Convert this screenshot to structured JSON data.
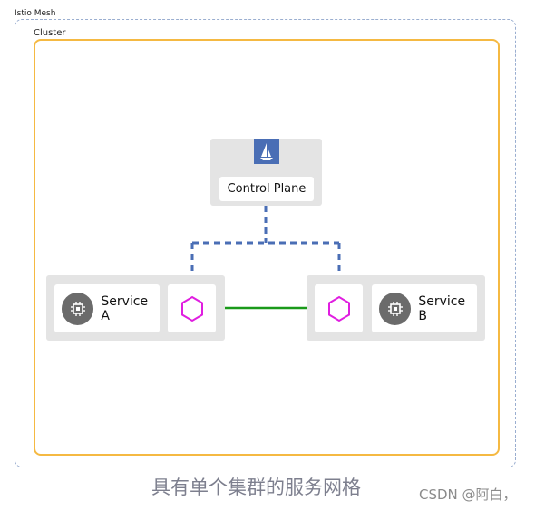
{
  "mesh": {
    "label": "Istio Mesh"
  },
  "cluster": {
    "label": "Cluster"
  },
  "control_plane": {
    "label": "Control Plane",
    "logo_icon": "istio-sail-icon",
    "logo_color": "#4a6eb5"
  },
  "services": [
    {
      "label": "Service A",
      "icon": "chip-icon"
    },
    {
      "label": "Service B",
      "icon": "chip-icon"
    }
  ],
  "proxies": [
    {
      "icon": "envoy-hexagon-icon",
      "color": "#e01ee0"
    },
    {
      "icon": "envoy-hexagon-icon",
      "color": "#e01ee0"
    }
  ],
  "connections": {
    "control_to_proxy_color": "#4a6eb5",
    "proxy_to_proxy_color": "#1a9a1a"
  },
  "caption": "具有单个集群的服务网格",
  "watermark": "CSDN @阿白，"
}
